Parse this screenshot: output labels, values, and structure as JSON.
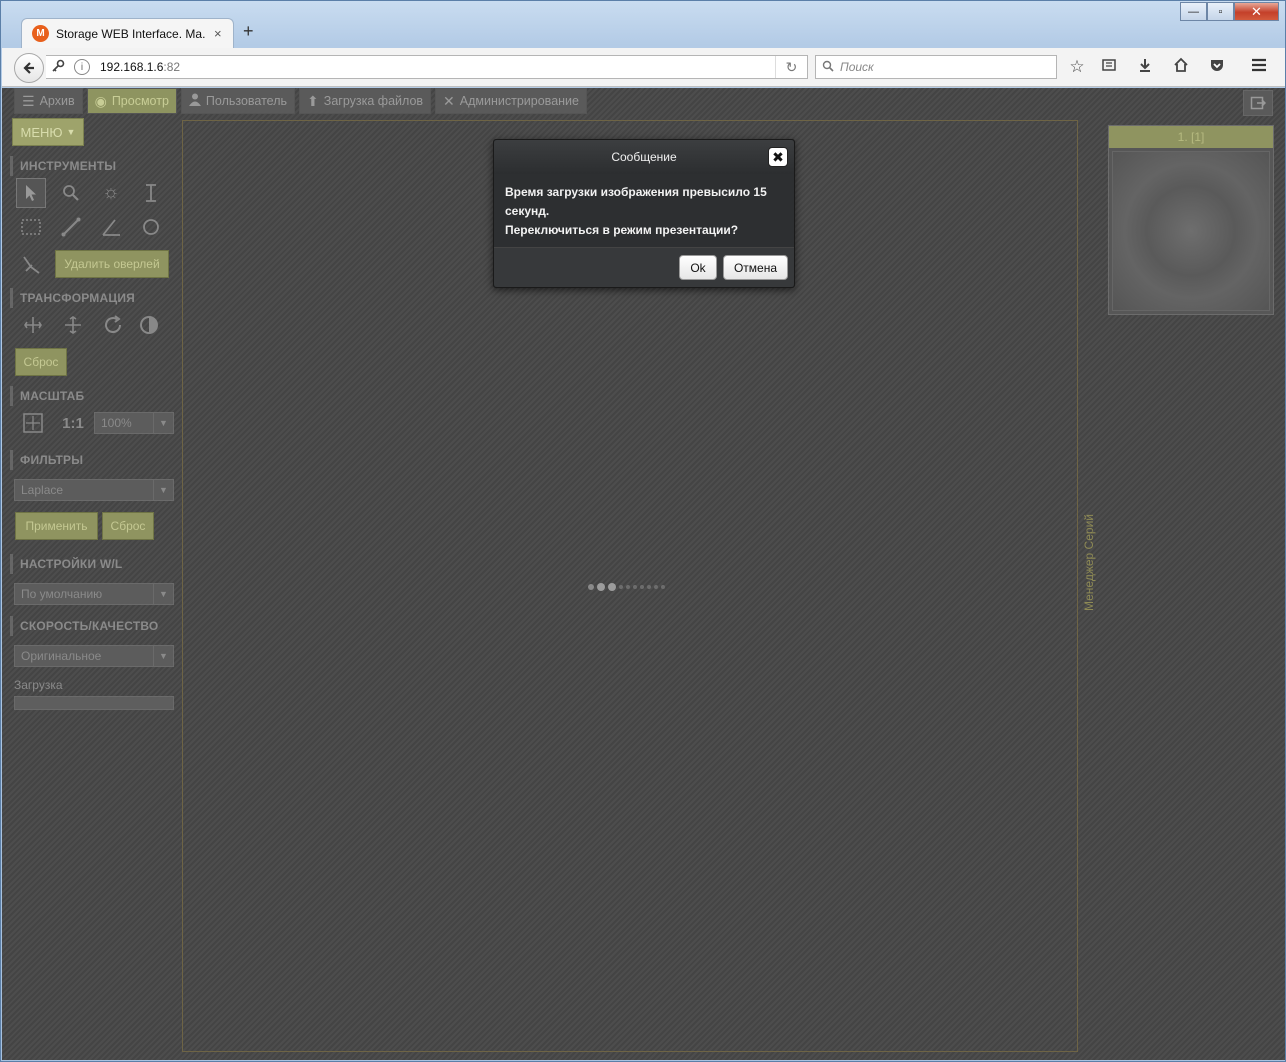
{
  "window": {
    "minimize": "—",
    "maximize": "▫",
    "close": "✕"
  },
  "tab": {
    "logo": "M",
    "title": "Storage WEB Interface. Ma...",
    "close": "×",
    "new_tab": "+"
  },
  "navbar": {
    "url_host": "192.168.1.6",
    "url_port": ":82",
    "search_placeholder": "Поиск"
  },
  "topmenu": [
    {
      "label": "Архив",
      "icon": "list-icon"
    },
    {
      "label": "Просмотр",
      "icon": "eye-icon"
    },
    {
      "label": "Пользователь",
      "icon": "user-icon"
    },
    {
      "label": "Загрузка файлов",
      "icon": "upload-icon"
    },
    {
      "label": "Администрирование",
      "icon": "tools-icon"
    }
  ],
  "sidebar": {
    "menu_label": "МЕНЮ",
    "tools_title": "ИНСТРУМЕНТЫ",
    "delete_overlay": "Удалить оверлей",
    "transform_title": "ТРАНСФОРМАЦИЯ",
    "transform_reset": "Сброс",
    "scale_title": "МАСШТАБ",
    "scale_one_to_one": "1:1",
    "scale_value": "100%",
    "filters_title": "ФИЛЬТРЫ",
    "filter_value": "Laplace",
    "apply": "Применить",
    "filter_reset": "Сброс",
    "wl_title": "НАСТРОЙКИ W/L",
    "wl_value": "По умолчанию",
    "quality_title": "СКОРОСТЬ/КАЧЕСТВО",
    "quality_value": "Оригинальное",
    "load_label": "Загрузка"
  },
  "series": {
    "manager_label": "Менеджер Серий",
    "header": "1. [1]"
  },
  "dialog": {
    "title": "Сообщение",
    "line1": "Время загрузки изображения превысило 15 секунд.",
    "line2": "Переключиться в режим презентации?",
    "ok": "Ok",
    "cancel": "Отмена"
  }
}
